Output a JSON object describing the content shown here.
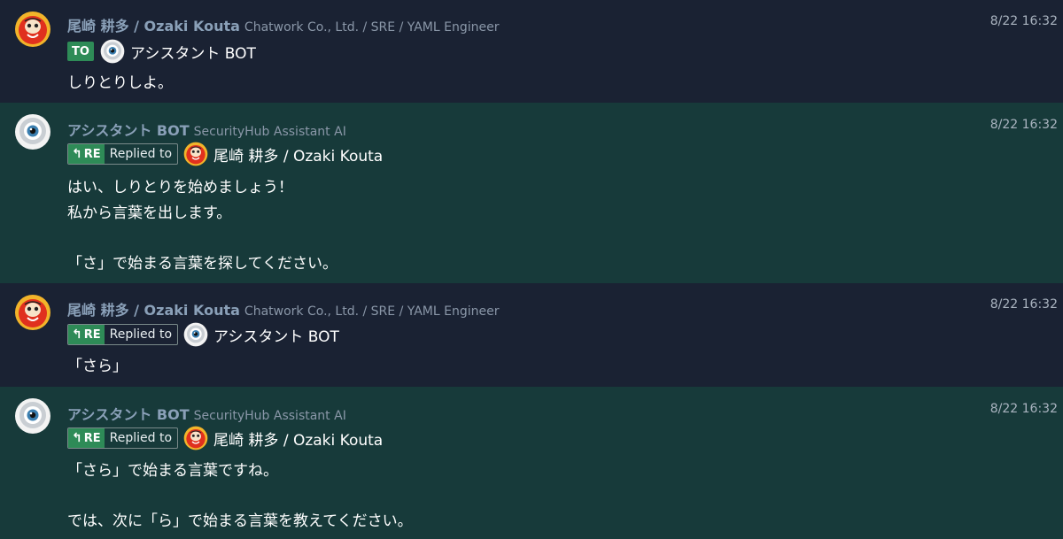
{
  "messages": [
    {
      "sender": "尾崎 耕多 / Ozaki Kouta",
      "org": "Chatwork Co., Ltd. / SRE / YAML Engineer",
      "time": "8/22 16:32",
      "tag": "TO",
      "target": "アシスタント BOT",
      "lines": [
        "しりとりしよ。"
      ]
    },
    {
      "sender": "アシスタント BOT",
      "org": "SecurityHub Assistant AI",
      "time": "8/22 16:32",
      "tag": "RE",
      "tag_text": "Replied to",
      "target": "尾崎 耕多 / Ozaki Kouta",
      "lines": [
        "はい、しりとりを始めましょう！",
        "私から言葉を出します。",
        "「さ」で始まる言葉を探してください。"
      ]
    },
    {
      "sender": "尾崎 耕多 / Ozaki Kouta",
      "org": "Chatwork Co., Ltd. / SRE / YAML Engineer",
      "time": "8/22 16:32",
      "tag": "RE",
      "tag_text": "Replied to",
      "target": "アシスタント BOT",
      "lines": [
        "「さら」"
      ]
    },
    {
      "sender": "アシスタント BOT",
      "org": "SecurityHub Assistant AI",
      "time": "8/22 16:32",
      "tag": "RE",
      "tag_text": "Replied to",
      "target": "尾崎 耕多 / Ozaki Kouta",
      "lines": [
        "「さら」で始まる言葉ですね。",
        "では、次に「ら」で始まる言葉を教えてください。"
      ]
    }
  ],
  "colors": {
    "user_bg": "#1a2233",
    "bot_bg": "#173a3a",
    "tag_green": "#2e8b57",
    "name": "#8aa0b8"
  },
  "icons": [
    "daruma-avatar-icon",
    "eye-bot-avatar-icon",
    "reply-arrow-icon"
  ]
}
